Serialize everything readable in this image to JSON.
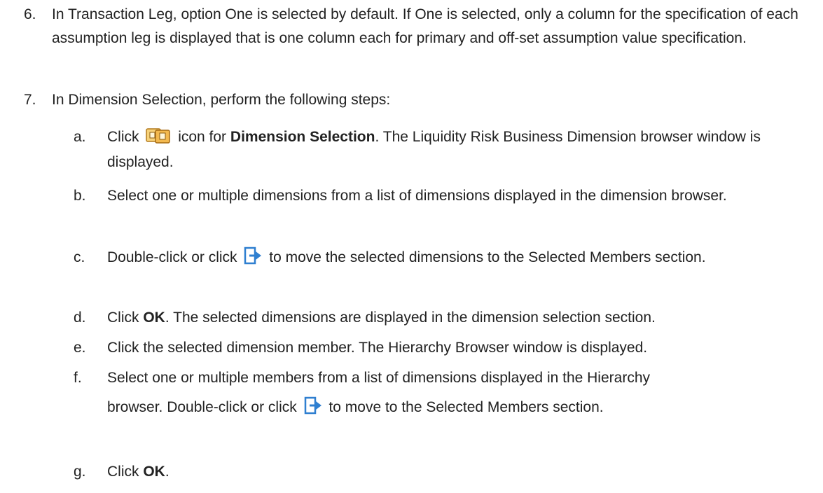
{
  "step6": {
    "number": "6.",
    "text": "In Transaction Leg, option One is selected by default. If One is selected, only a column for the specification of each assumption leg is displayed that is one column each for primary and off-set assumption value specification."
  },
  "step7": {
    "number": "7.",
    "text": "In Dimension Selection, perform the following steps:",
    "substeps": {
      "a": {
        "letter": "a.",
        "pre": "Click",
        "icon": "dimension-selection-icon",
        "mid": "icon for",
        "bold": "Dimension Selection",
        "post": ". The Liquidity Risk Business Dimension browser window is displayed."
      },
      "b": {
        "letter": "b.",
        "text": "Select one or multiple dimensions from a list of dimensions displayed in the dimension browser."
      },
      "c": {
        "letter": "c.",
        "pre": "Double-click or click",
        "icon": "move-right-arrow-icon",
        "post": "to move the selected dimensions to the Selected Members section."
      },
      "d": {
        "letter": "d.",
        "pre": "Click",
        "bold": "OK",
        "post": ". The selected dimensions are displayed in the dimension selection section."
      },
      "e": {
        "letter": "e.",
        "text": "Click the selected dimension member. The Hierarchy Browser window is displayed."
      },
      "f": {
        "letter": "f.",
        "line1": "Select one or multiple members from a list of dimensions displayed in the Hierarchy",
        "pre": "browser. Double-click or click",
        "icon": "move-right-arrow-icon",
        "post": "to move to the Selected Members section."
      },
      "g": {
        "letter": "g.",
        "pre": "Click",
        "bold": "OK",
        "post": "."
      }
    }
  },
  "colors": {
    "text": "#222222",
    "icon_orange": "#e8a23a",
    "icon_blue": "#2f7fd0"
  }
}
